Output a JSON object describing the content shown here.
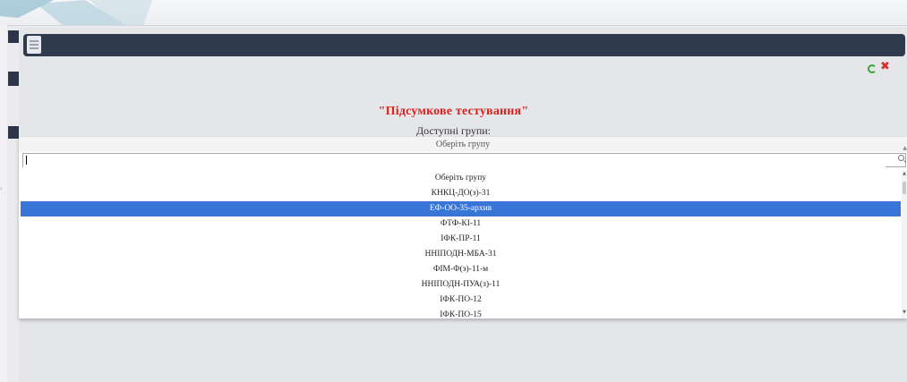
{
  "header": {
    "menu_icon": "menu-icon",
    "refresh_icon": "refresh-icon",
    "close_icon": "close-icon"
  },
  "content": {
    "title": "\"Підсумкове тестування\"",
    "available_groups_label": "Доступні групи:"
  },
  "group_select": {
    "selected_value": "Оберіть групу",
    "search_value": "",
    "highlighted_index": 2,
    "options": [
      "Оберіть групу",
      "КНКЦ-ДО(з)-31",
      "ЕФ-ОО-35-архив",
      "ФТФ-КІ-11",
      "ІФК-ПР-11",
      "ННІПОДН-МБА-31",
      "ФІМ-Ф(з)-11-м",
      "ННІПОДН-ПУА(з)-11",
      "ІФК-ПО-12",
      "ІФК-ПО-15"
    ]
  },
  "colors": {
    "header_bg": "#2f3a4d",
    "title_red": "#e0201c",
    "highlight_blue": "#3875d7"
  }
}
